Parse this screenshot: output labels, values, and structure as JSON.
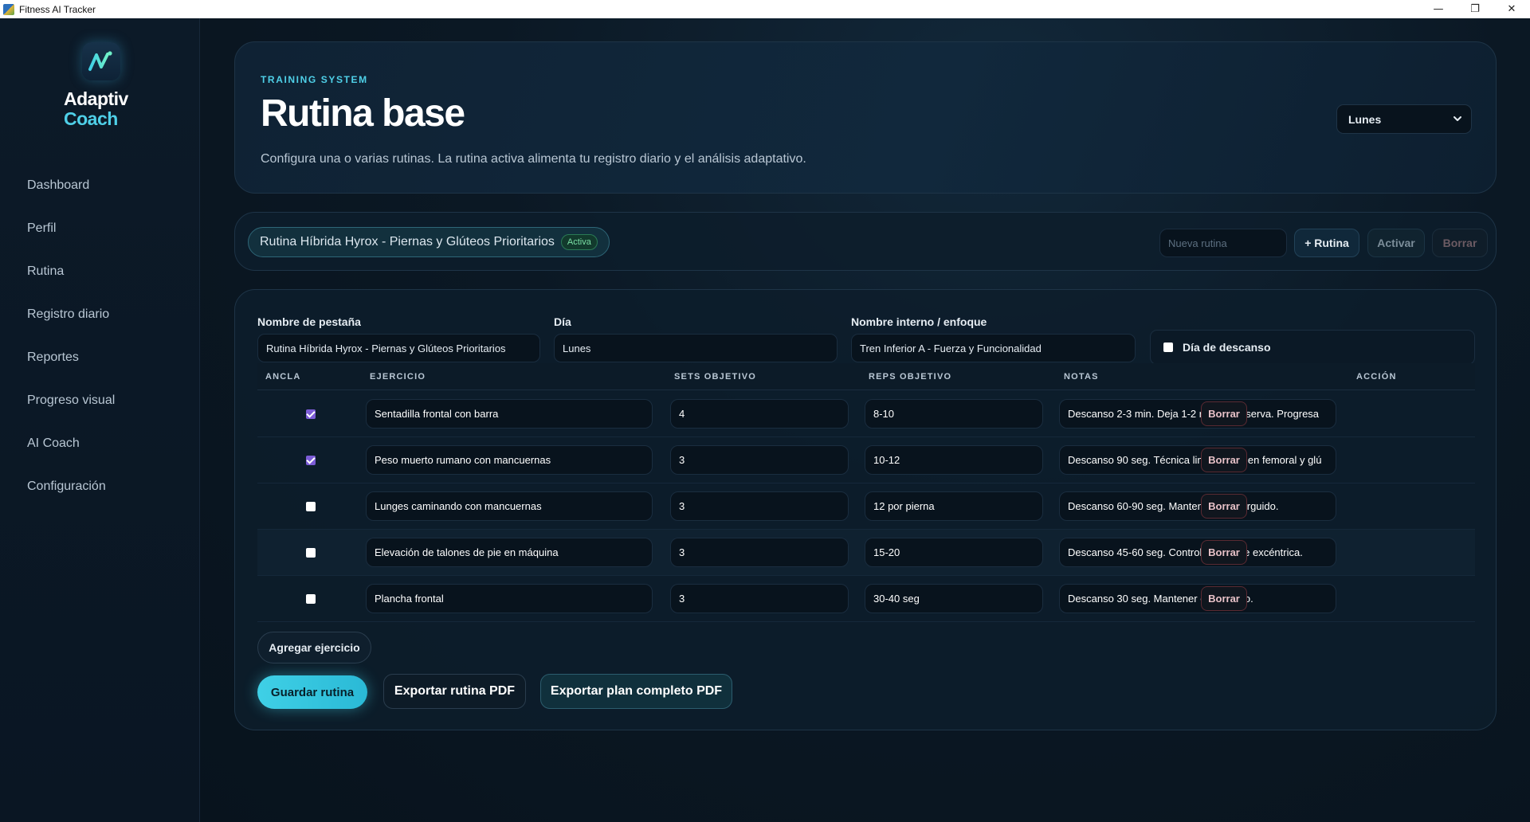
{
  "window": {
    "title": "Fitness AI Tracker"
  },
  "brand": {
    "line1": "Adaptiv",
    "line2": "Coach"
  },
  "sidebar": {
    "items": [
      {
        "label": "Dashboard"
      },
      {
        "label": "Perfil"
      },
      {
        "label": "Rutina"
      },
      {
        "label": "Registro diario"
      },
      {
        "label": "Reportes"
      },
      {
        "label": "Progreso visual"
      },
      {
        "label": "AI Coach"
      },
      {
        "label": "Configuración"
      }
    ]
  },
  "header": {
    "eyebrow": "TRAINING SYSTEM",
    "title": "Rutina base",
    "description": "Configura una o varias rutinas. La rutina activa alimenta tu registro diario y el análisis adaptativo.",
    "day_selected": "Lunes"
  },
  "routines": {
    "current_name": "Rutina Híbrida Hyrox - Piernas y Glúteos Prioritarios",
    "status_badge": "Activa",
    "new_placeholder": "Nueva rutina",
    "add_label": "+ Rutina",
    "activate_label": "Activar",
    "delete_label": "Borrar"
  },
  "editor": {
    "tab_name_label": "Nombre de pestaña",
    "tab_name_value": "Rutina Híbrida Hyrox - Piernas y Glúteos Prioritarios",
    "day_label": "Día",
    "day_value": "Lunes",
    "focus_label": "Nombre interno / enfoque",
    "focus_value": "Tren Inferior A - Fuerza y Funcionalidad",
    "rest_day_label": "Día de descanso",
    "rest_day_checked": false,
    "columns": {
      "anchor": "ANCLA",
      "exercise": "EJERCICIO",
      "sets": "SETS OBJETIVO",
      "reps": "REPS OBJETIVO",
      "notes": "NOTAS",
      "action": "ACCIÓN"
    },
    "rows": [
      {
        "anchor": true,
        "exercise": "Sentadilla frontal con barra",
        "sets": "4",
        "reps": "8-10",
        "notes": "Descanso 2-3 min. Deja 1-2 reps en reserva. Progresa",
        "action": "Borrar"
      },
      {
        "anchor": true,
        "exercise": "Peso muerto rumano con mancuernas",
        "sets": "3",
        "reps": "10-12",
        "notes": "Descanso 90 seg. Técnica limpia, foco en femoral y glú",
        "action": "Borrar"
      },
      {
        "anchor": false,
        "exercise": "Lunges caminando con mancuernas",
        "sets": "3",
        "reps": "12 por pierna",
        "notes": "Descanso 60-90 seg. Mantener torso erguido.",
        "action": "Borrar"
      },
      {
        "anchor": false,
        "exercise": "Elevación de talones de pie en máquina",
        "sets": "3",
        "reps": "15-20",
        "notes": "Descanso 45-60 seg. Control en la fase excéntrica.",
        "action": "Borrar"
      },
      {
        "anchor": false,
        "exercise": "Plancha frontal",
        "sets": "3",
        "reps": "30-40 seg",
        "notes": "Descanso 30 seg. Mantener core activo.",
        "action": "Borrar"
      }
    ],
    "add_exercise_label": "Agregar ejercicio",
    "save_label": "Guardar rutina",
    "export_label": "Exportar rutina PDF",
    "export_full_label": "Exportar plan completo PDF"
  },
  "colors": {
    "accent": "#4fd0e8",
    "background": "#0a1520",
    "checkbox_on": "#7c5cd6"
  },
  "icons": [
    "app-icon",
    "logo-mark-icon",
    "chevron-down-icon",
    "minimize-icon",
    "maximize-icon",
    "close-icon"
  ]
}
